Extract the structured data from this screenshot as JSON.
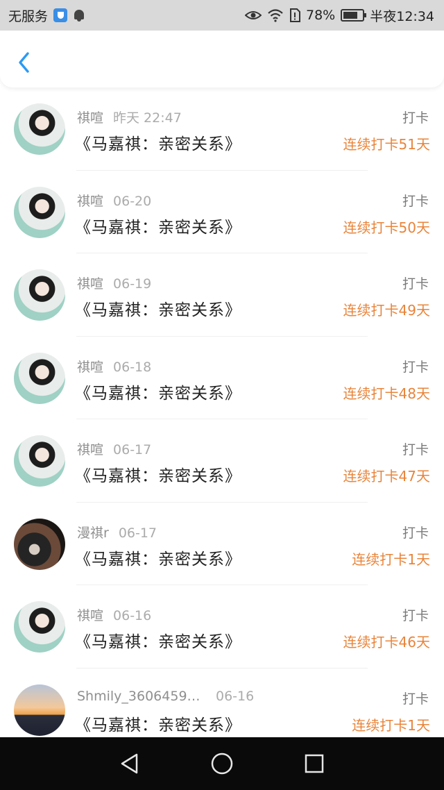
{
  "status_bar": {
    "carrier": "无服务",
    "battery": "78%",
    "battery_level": 0.78,
    "time": "半夜12:34",
    "icons": [
      "shield-icon",
      "bell-icon",
      "eye-icon",
      "wifi-icon",
      "sim-icon",
      "battery-icon"
    ]
  },
  "header": {
    "back_icon": "chevron-left-icon",
    "accent": "#2b9af3"
  },
  "colors": {
    "streak": "#e8843a",
    "meta": "#8f8f8f",
    "title": "#222222"
  },
  "checkins": [
    {
      "user": "祺喧",
      "time": "昨天 22:47",
      "title": "《马嘉祺：亲密关系》",
      "type": "打卡",
      "streak": "连续打卡51天",
      "avatar": "avatar-a"
    },
    {
      "user": "祺喧",
      "time": "06-20",
      "title": "《马嘉祺：亲密关系》",
      "type": "打卡",
      "streak": "连续打卡50天",
      "avatar": "avatar-a"
    },
    {
      "user": "祺喧",
      "time": "06-19",
      "title": "《马嘉祺：亲密关系》",
      "type": "打卡",
      "streak": "连续打卡49天",
      "avatar": "avatar-a"
    },
    {
      "user": "祺喧",
      "time": "06-18",
      "title": "《马嘉祺：亲密关系》",
      "type": "打卡",
      "streak": "连续打卡48天",
      "avatar": "avatar-a"
    },
    {
      "user": "祺喧",
      "time": "06-17",
      "title": "《马嘉祺：亲密关系》",
      "type": "打卡",
      "streak": "连续打卡47天",
      "avatar": "avatar-a"
    },
    {
      "user": "漫祺r",
      "time": "06-17",
      "title": "《马嘉祺：亲密关系》",
      "type": "打卡",
      "streak": "连续打卡1天",
      "avatar": "avatar-b"
    },
    {
      "user": "祺喧",
      "time": "06-16",
      "title": "《马嘉祺：亲密关系》",
      "type": "打卡",
      "streak": "连续打卡46天",
      "avatar": "avatar-a"
    },
    {
      "user": "Shmily_36064593...",
      "time": "06-16",
      "title": "《马嘉祺：亲密关系》",
      "type": "打卡",
      "streak": "连续打卡1天",
      "avatar": "avatar-c"
    }
  ],
  "nav_bar": {
    "icons": [
      "back-triangle-icon",
      "home-circle-icon",
      "recents-square-icon"
    ]
  }
}
